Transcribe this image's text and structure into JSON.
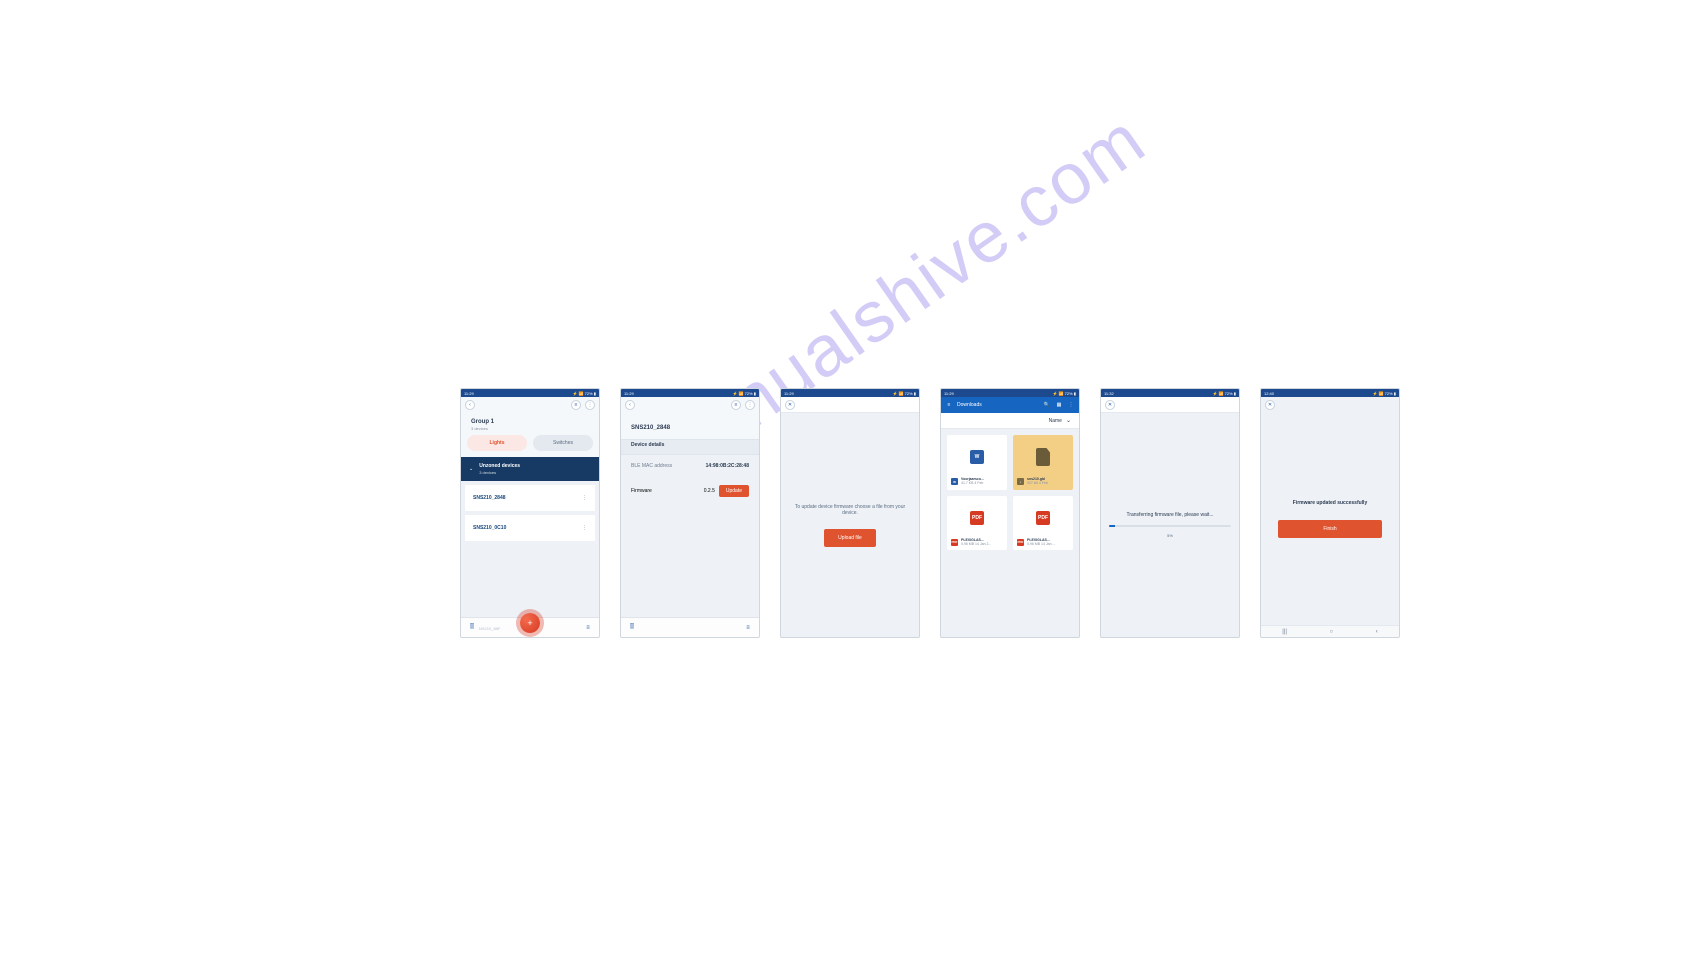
{
  "watermark": "manualshive.com",
  "status": {
    "time_a": "11:29",
    "icons_a": "▣ ▸",
    "right": "⚡ 📶 72% ▮",
    "time_b": "11:32",
    "time_c": "12:40"
  },
  "s1": {
    "group_title": "Group 1",
    "group_sub": "3 devices",
    "tab_lights": "Lights",
    "tab_switches": "Switches",
    "section_title": "Unzoned devices",
    "section_sub": "3 devices",
    "devices": [
      "SNS210_2848",
      "SNS210_0C10"
    ],
    "faint": "NS210_88F"
  },
  "s2": {
    "title": "SNS210_2848",
    "section": "Device details",
    "row1_k": "BLE MAC address",
    "row1_v": "14:98:0B:2C:28:48",
    "row2_k": "Firmware",
    "row2_v": "0.2.5",
    "update": "Update"
  },
  "s3": {
    "msg": "To update device firmware choose a file from your device.",
    "btn": "Upload file"
  },
  "s4": {
    "title": "Downloads",
    "sort": "Name",
    "files": [
      {
        "type": "w",
        "name": "Voorjaarsco...",
        "meta": "41.7 KB 4 Feb"
      },
      {
        "type": "file",
        "name": "sns210.gbl",
        "meta": "927 kB 4 Feb"
      },
      {
        "type": "pdf",
        "name": "PLEXIGLAS...",
        "meta": "0,96 MB 14 Jan 2..."
      },
      {
        "type": "pdf",
        "name": "PLEXIGLAS...",
        "meta": "0,96 MB 14 Jan ..."
      }
    ]
  },
  "s5": {
    "msg": "Transferring firmware file, please wait...",
    "pct_text": "5%",
    "pct_val": 5
  },
  "s6": {
    "msg": "Firmware updated successfully",
    "btn": "Finish"
  }
}
